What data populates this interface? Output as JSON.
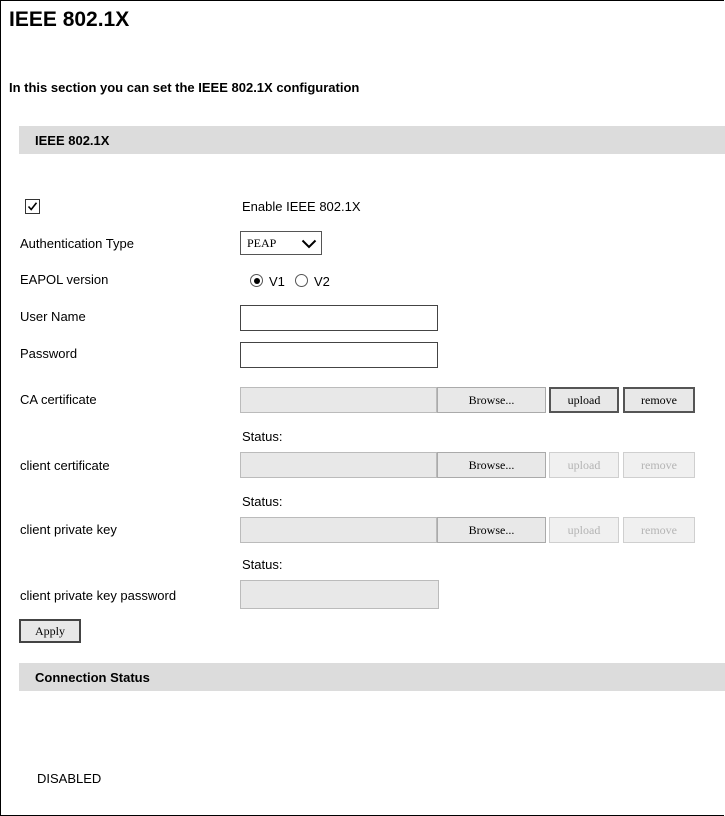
{
  "page": {
    "title": "IEEE 802.1X",
    "description": "In this section you can set the IEEE 802.1X configuration"
  },
  "section_ieee": {
    "header": "IEEE 802.1X"
  },
  "form": {
    "enable": {
      "checked": true,
      "label": "Enable IEEE 802.1X"
    },
    "auth_type": {
      "label": "Authentication Type",
      "value": "PEAP"
    },
    "eapol": {
      "label": "EAPOL version",
      "options": [
        "V1",
        "V2"
      ],
      "selected": "V1"
    },
    "username": {
      "label": "User Name",
      "value": ""
    },
    "password": {
      "label": "Password",
      "value": ""
    },
    "ca_cert": {
      "label": "CA certificate",
      "browse": "Browse...",
      "upload": "upload",
      "remove": "remove",
      "status_label": "Status:"
    },
    "client_cert": {
      "label": "client certificate",
      "browse": "Browse...",
      "upload": "upload",
      "remove": "remove",
      "status_label": "Status:"
    },
    "client_key": {
      "label": "client private key",
      "browse": "Browse...",
      "upload": "upload",
      "remove": "remove",
      "status_label": "Status:"
    },
    "client_key_password": {
      "label": "client private key password",
      "value": ""
    },
    "apply": "Apply"
  },
  "section_status": {
    "header": "Connection Status",
    "value": "DISABLED"
  }
}
